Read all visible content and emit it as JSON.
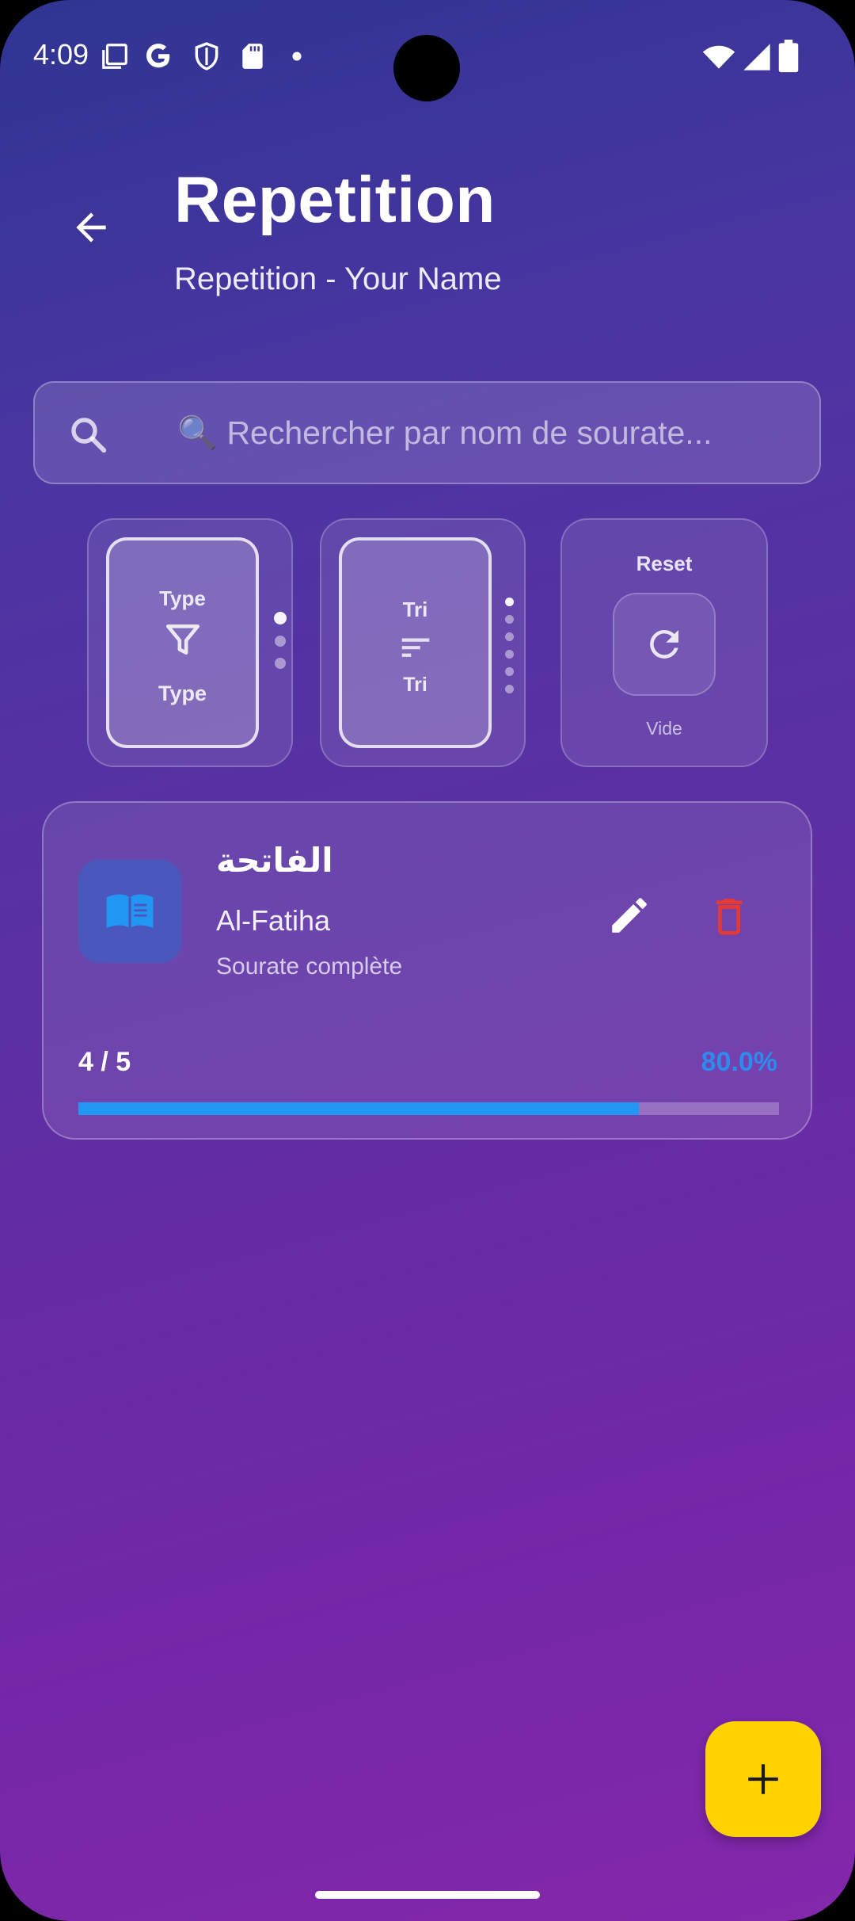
{
  "status_bar": {
    "time": "4:09",
    "left_icons": [
      "gallery-icon",
      "google-icon",
      "shield-icon",
      "sd-card-icon",
      "dot-icon"
    ],
    "right_icons": [
      "wifi-icon",
      "signal-icon",
      "battery-icon"
    ]
  },
  "header": {
    "title": "Repetition",
    "subtitle": "Repetition - Your Name",
    "back_icon": "arrow-back-icon"
  },
  "search": {
    "placeholder": "🔍 Rechercher par nom de sourate...",
    "value": "",
    "icon": "search-icon"
  },
  "filters": {
    "type_picker": {
      "header": "Type",
      "selected": "Type",
      "icon": "filter-icon",
      "option_count": 3,
      "selected_index": 0
    },
    "sort_picker": {
      "header": "Tri",
      "selected": "Tri",
      "icon": "sort-icon",
      "option_count": 6,
      "selected_index": 0
    },
    "reset": {
      "header": "Reset",
      "caption": "Vide",
      "icon": "refresh-icon"
    }
  },
  "items": [
    {
      "arabic_name": "الفاتحة",
      "latin_name": "Al-Fatiha",
      "type": "Sourate complète",
      "progress_text": "4 / 5",
      "progress_percent_text": "80.0%",
      "progress": 0.8,
      "icon": "book-icon",
      "edit_icon": "edit-icon",
      "delete_icon": "trash-icon"
    }
  ],
  "fab": {
    "icon": "plus-icon"
  },
  "colors": {
    "accent_yellow": "#ffd200",
    "progress_blue": "#2196f3",
    "delete_red": "#e53935",
    "book_tile": "#4a58bd"
  }
}
